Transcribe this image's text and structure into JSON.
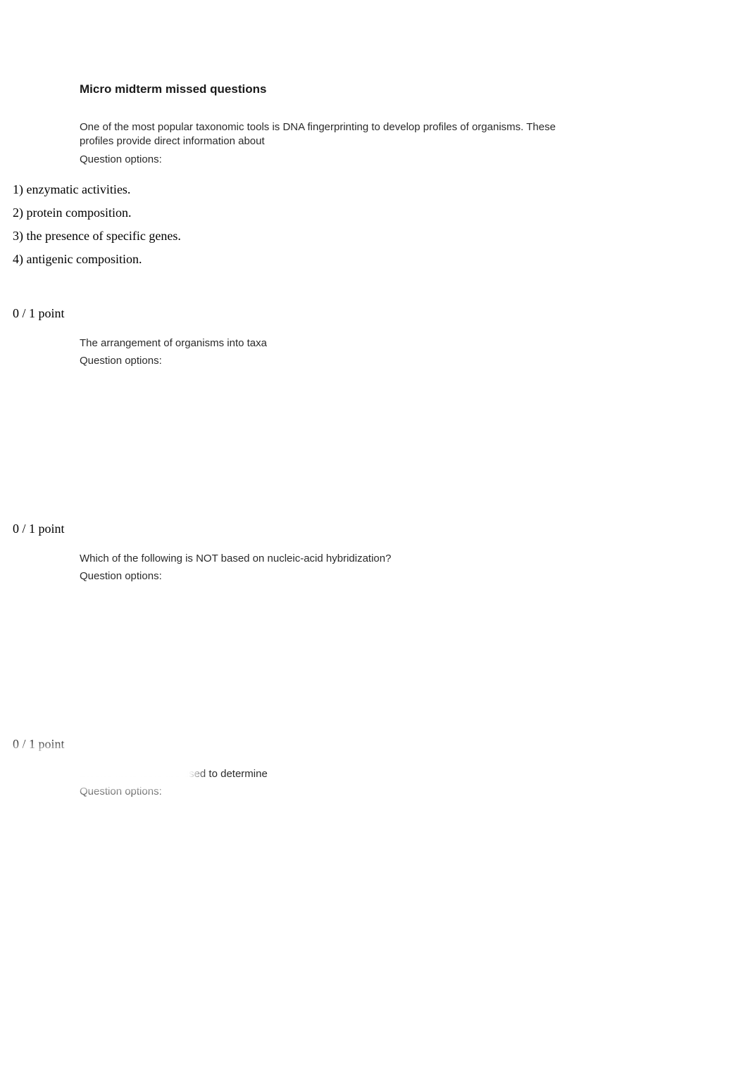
{
  "title": "Micro midterm missed questions",
  "questions": [
    {
      "prompt": "One of the most popular taxonomic tools is DNA fingerprinting to develop profiles of organisms. These profiles provide direct information about",
      "options_label": "Question options:",
      "answers": [
        "1) enzymatic activities.",
        "2) protein composition.",
        "3) the presence of specific genes.",
        "4) antigenic composition."
      ],
      "score": "0 / 1 point"
    },
    {
      "prompt": "The arrangement of organisms into taxa",
      "options_label": "Question options:",
      "score": "0 / 1 point"
    },
    {
      "prompt": "Which of the following is NOT based on nucleic-acid hybridization?",
      "options_label": "Question options:",
      "score": "0 / 1 point"
    },
    {
      "prompt": "Biochemical tests are used to determine",
      "options_label": "Question options:"
    }
  ]
}
